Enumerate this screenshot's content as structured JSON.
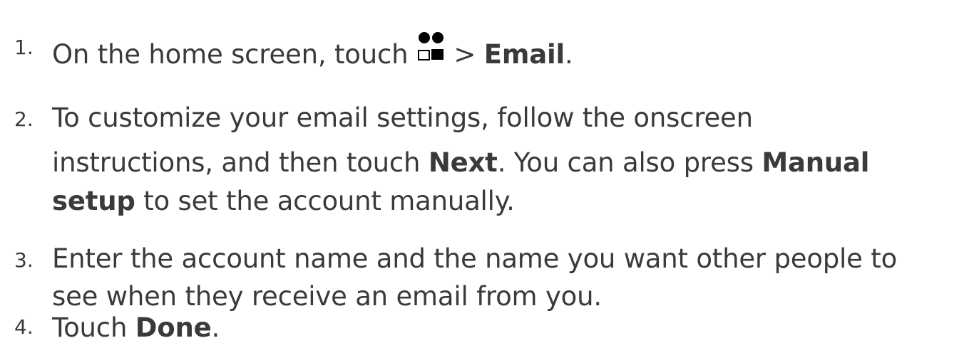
{
  "steps": [
    {
      "number": "1.",
      "lines": [
        {
          "pre": "On the home screen, touch",
          "mid": ">",
          "bold": "Email",
          "post": "."
        }
      ],
      "icon": "apps-grid-icon"
    },
    {
      "number": "2.",
      "lines": [
        {
          "text": "To customize your email settings, follow the onscreen"
        },
        {
          "pre": "instructions, and then touch ",
          "bold": "Next",
          "post": ". You can also press ",
          "bold2": "Manual"
        },
        {
          "bold": "setup",
          "post": " to set the account manually."
        }
      ]
    },
    {
      "number": "3.",
      "lines": [
        {
          "text": "Enter the account name and the name you want other people to"
        },
        {
          "text": "see when they receive an email from you."
        }
      ]
    },
    {
      "number": "4.",
      "lines": [
        {
          "pre": "Touch ",
          "bold": "Done",
          "post": "."
        }
      ]
    }
  ]
}
